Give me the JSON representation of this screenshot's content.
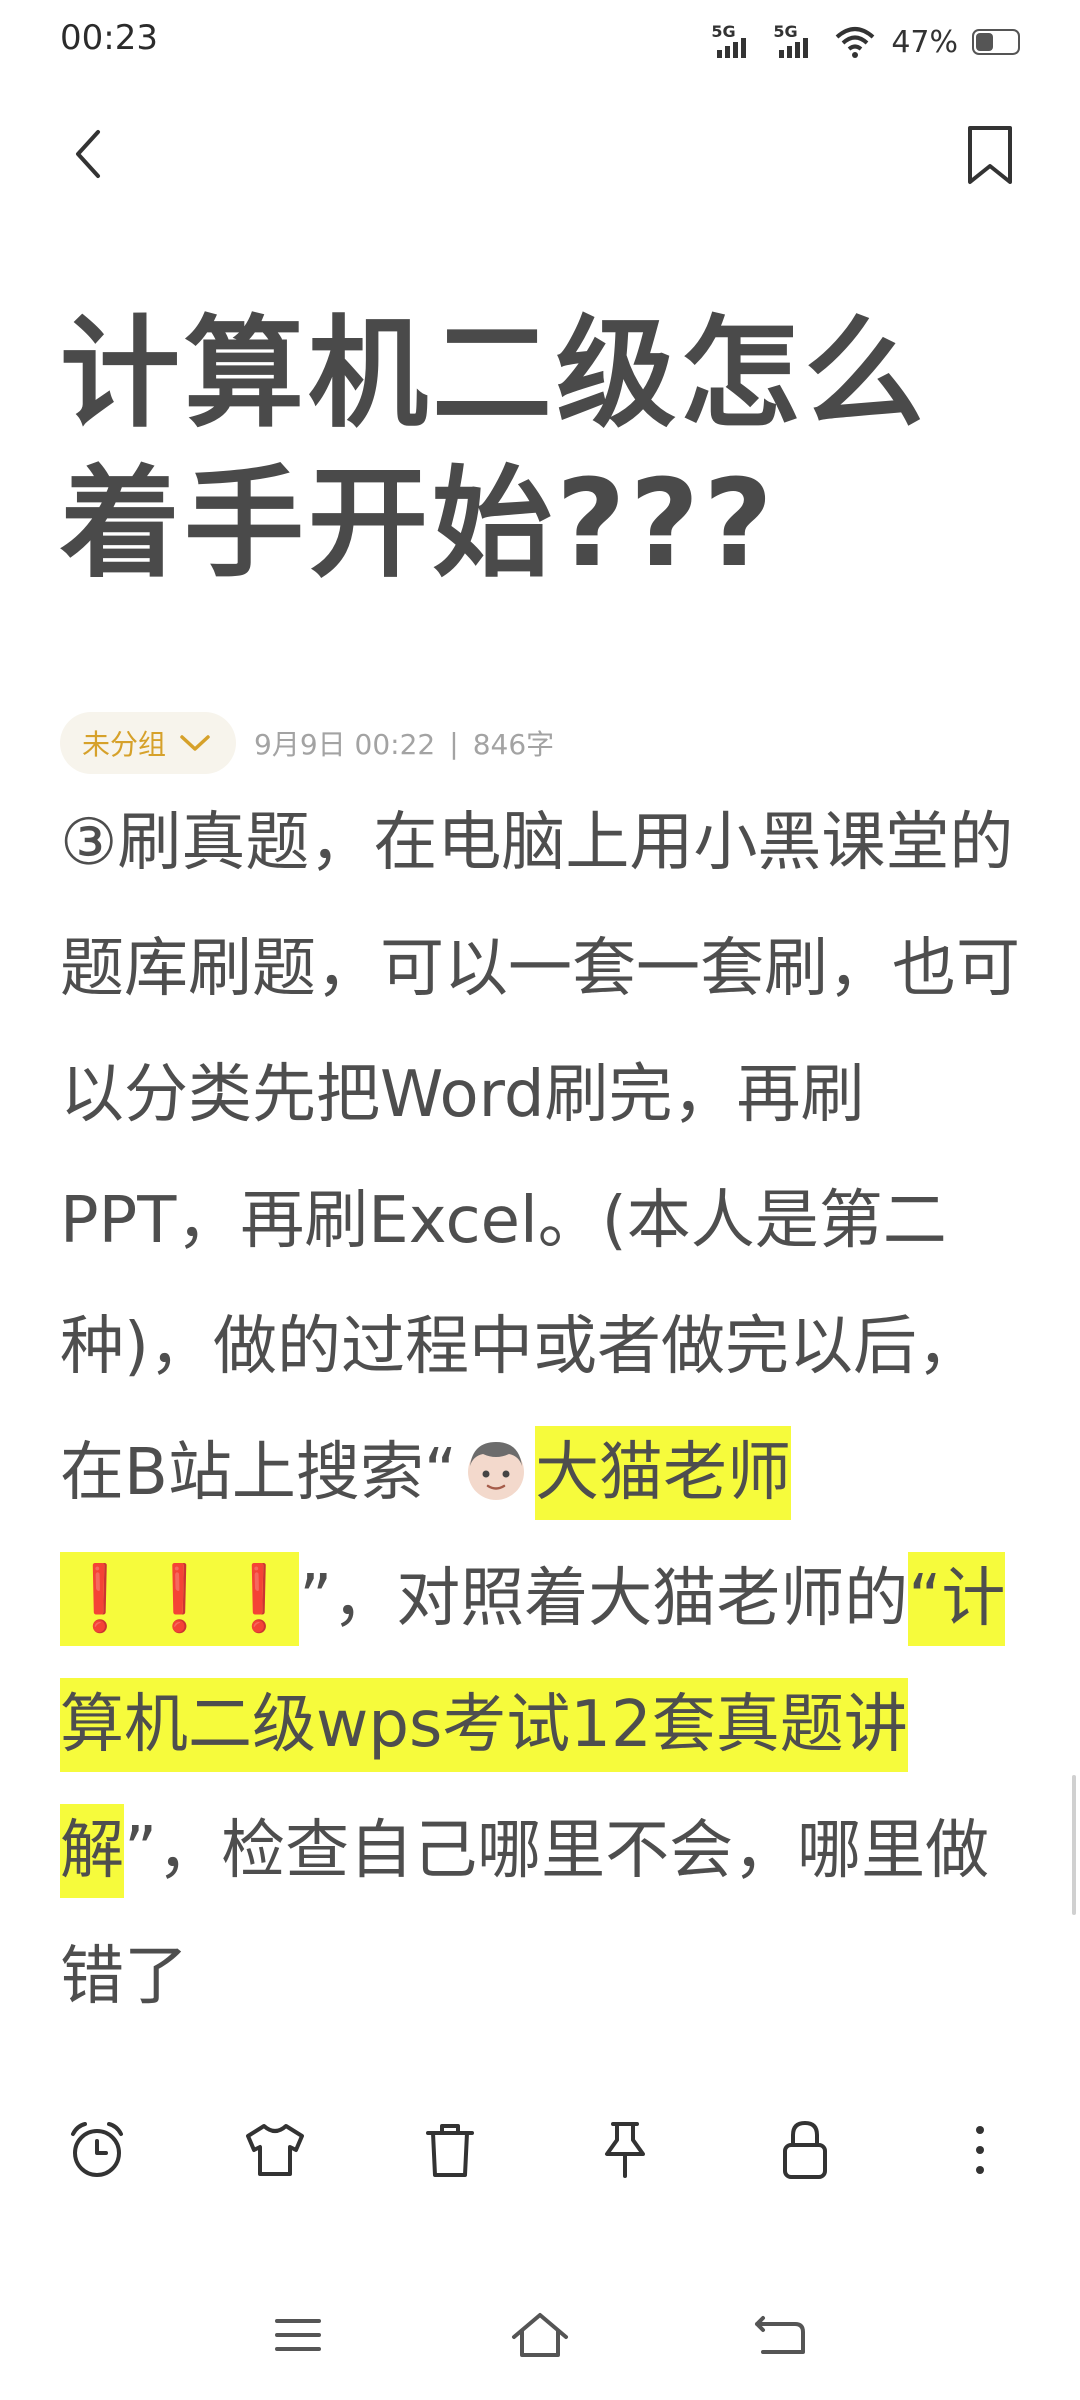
{
  "status_bar": {
    "time": "00:23",
    "signal1_label": "5G",
    "signal2_label": "5G",
    "battery_percent": "47%",
    "battery_level": 0.47
  },
  "nav": {
    "back_icon": "chevron-left-icon",
    "bookmark_icon": "bookmark-icon"
  },
  "note": {
    "title": "计算机二级怎么着手开始???",
    "group_label": "未分组",
    "date": "9月9日 00:22",
    "separator": "|",
    "word_count": "846字",
    "body": {
      "part1": "③刷真题，在电脑上用小黑课堂的题库刷题，可以一套一套刷，也可以分类先把Word刷完，再刷PPT，再刷Excel。(本人是第二种)，做的过程中或者做完以后，在B站上搜索“",
      "hl1": "大猫老师",
      "excl": "❗❗❗",
      "part2": "”，对照着大猫老师的",
      "hl2": "“计算机二级wps考试12套真题讲解",
      "part3": "”，检查自己哪里不会，哪里做错了"
    }
  },
  "toolbar": [
    "alarm-clock-icon",
    "tshirt-icon",
    "trash-icon",
    "pin-icon",
    "lock-icon",
    "more-vertical-icon"
  ],
  "system_nav": [
    "menu-icon",
    "home-icon",
    "back-arrow-icon"
  ],
  "colors": {
    "accent": "#d6a12a",
    "highlight": "#f6fb3c",
    "text": "#4e4e4e",
    "exclamation": "#e8552b"
  }
}
